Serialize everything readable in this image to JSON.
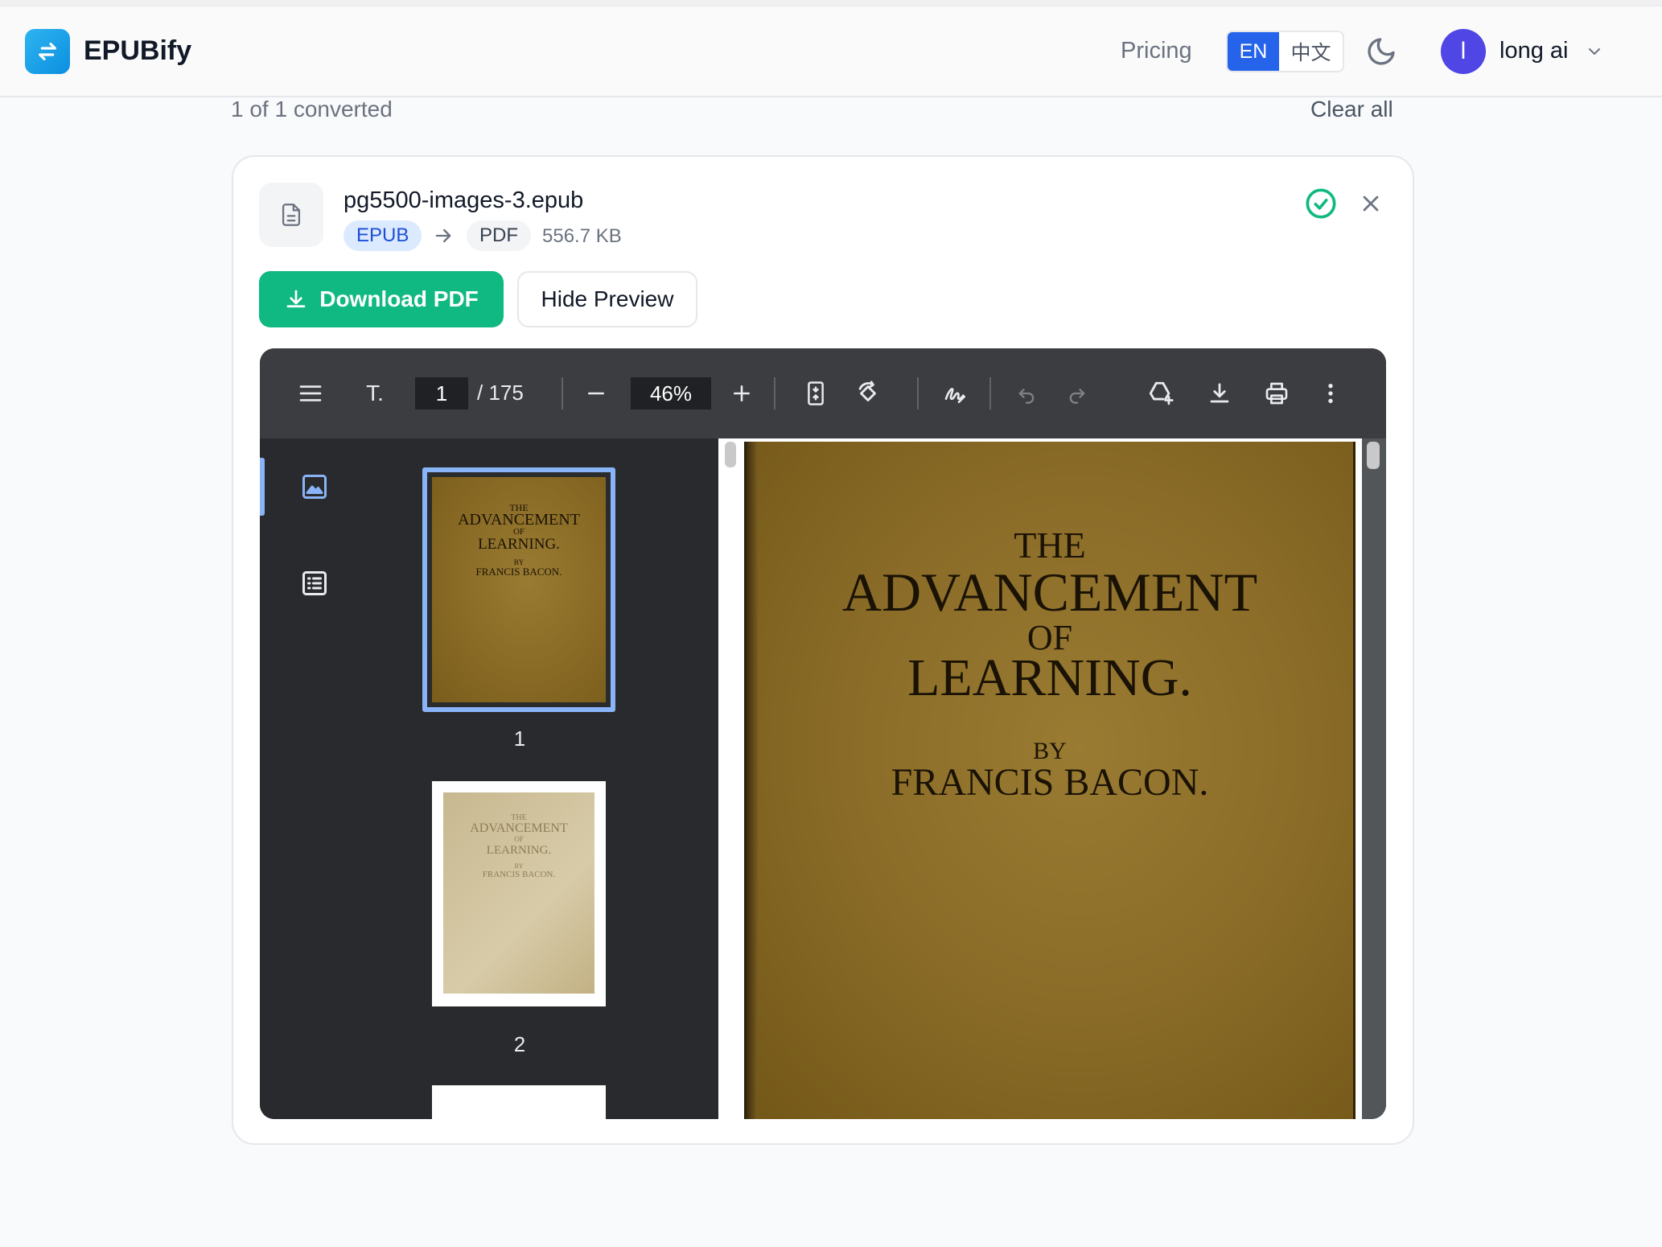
{
  "header": {
    "brand": "EPUBify",
    "pricing": "Pricing",
    "lang_en": "EN",
    "lang_zh": "中文",
    "avatar_initial": "l",
    "username": "long ai"
  },
  "summary": {
    "converted": "1 of 1 converted",
    "clear_all": "Clear all"
  },
  "file": {
    "name": "pg5500-images-3.epub",
    "from_format": "EPUB",
    "to_format": "PDF",
    "size": "556.7 KB",
    "download_label": "Download PDF",
    "hide_preview_label": "Hide Preview"
  },
  "viewer": {
    "text_tool": "T.",
    "current_page": "1",
    "total_pages": "/ 175",
    "zoom": "46%",
    "thumbnails": [
      {
        "label": "1"
      },
      {
        "label": "2"
      }
    ]
  },
  "cover": {
    "line1": "THE",
    "line2": "ADVANCEMENT",
    "line3": "OF",
    "line4": "LEARNING.",
    "line5": "BY",
    "line6": "FRANCIS BACON."
  },
  "colors": {
    "primary": "#2563eb",
    "success": "#10b981",
    "accent": "#8ab4f8"
  }
}
